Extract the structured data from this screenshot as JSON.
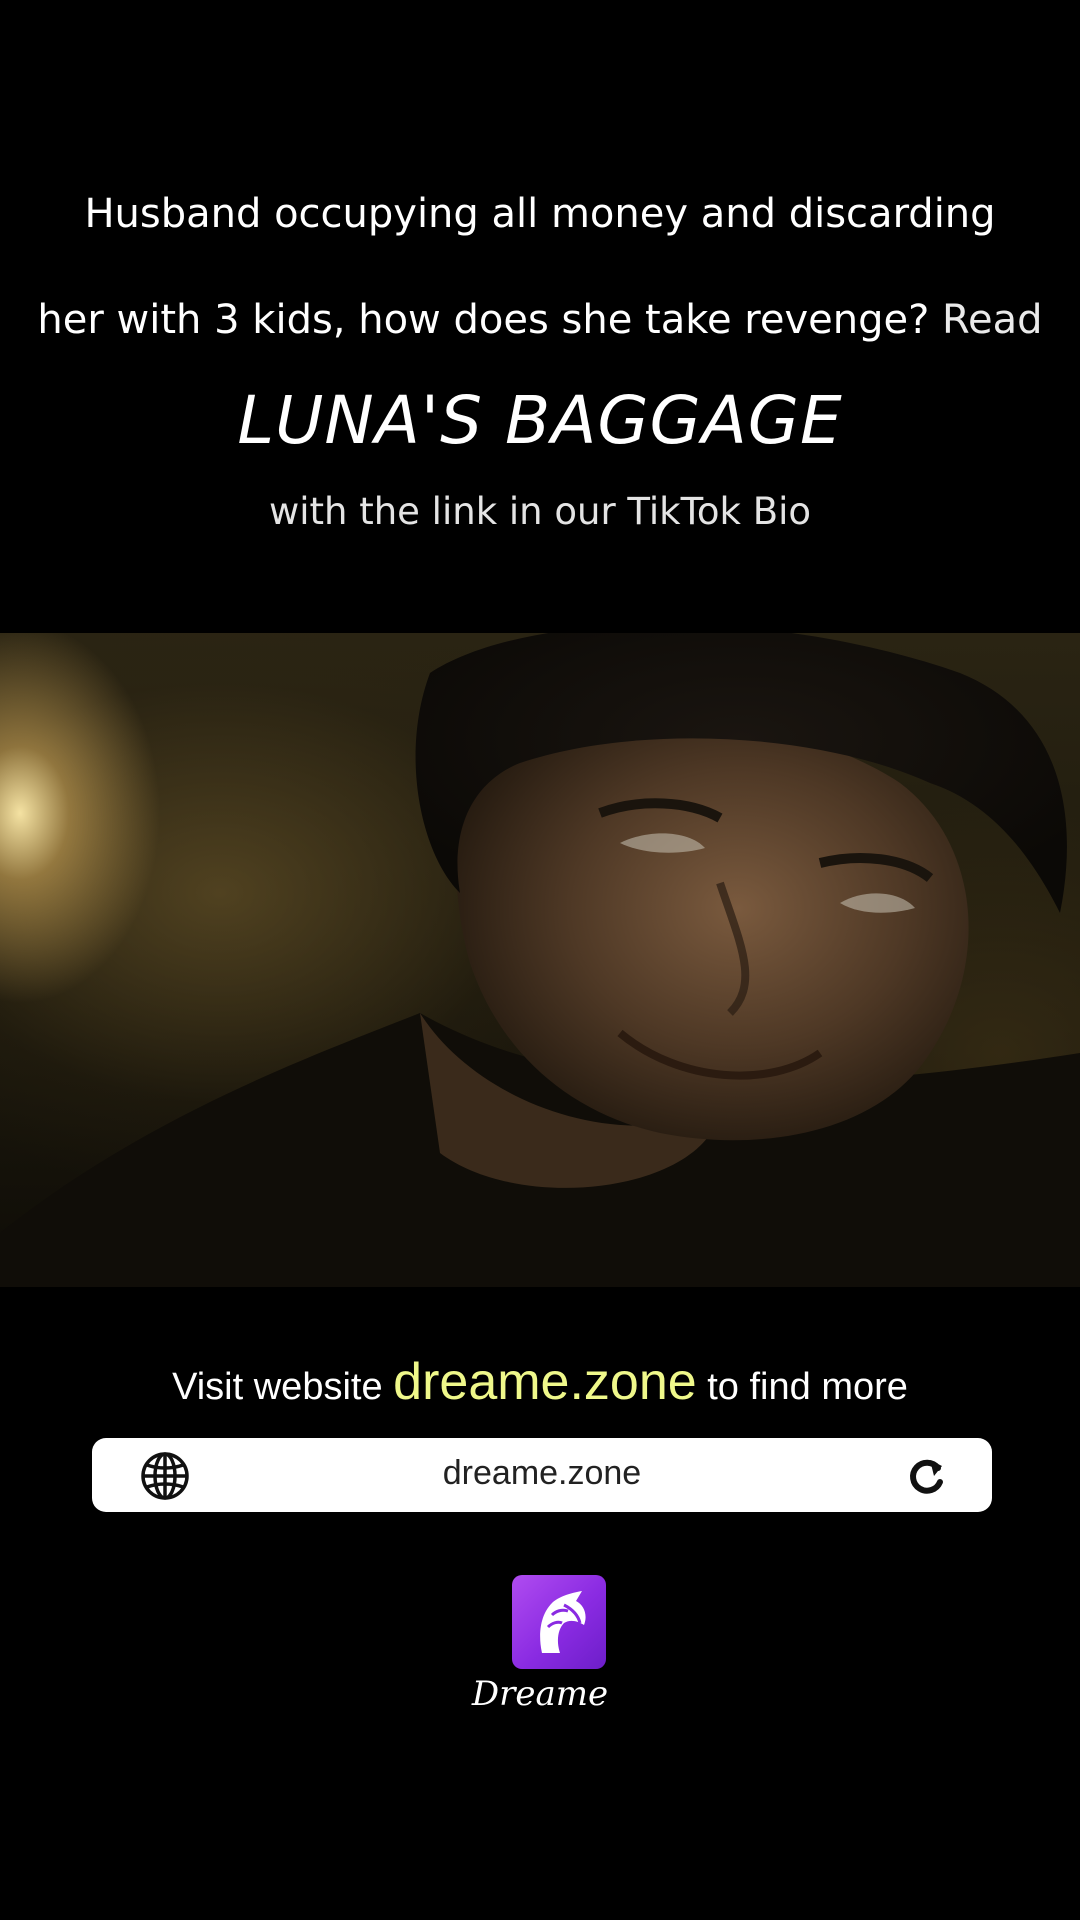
{
  "caption": {
    "line1": "Husband occupying all money and discarding",
    "line2": "her with 3 kids, how does she take revenge?",
    "read_word": "Read",
    "book_title": "LUNA'S BAGGAGE",
    "bio_line": "with the link in our TikTok Bio"
  },
  "promo": {
    "visit_prefix": "Visit website",
    "domain": "dreame.zone",
    "visit_suffix": "to find more"
  },
  "url_bar": {
    "url": "dreame.zone",
    "left_icon": "globe-icon",
    "right_icon": "reload-icon"
  },
  "brand": {
    "name": "Dreame",
    "logo_icon": "dreame-unicorn-logo"
  },
  "colors": {
    "background": "#000000",
    "domain_highlight": "#eff88a",
    "logo_purple": "#8a2be2"
  }
}
